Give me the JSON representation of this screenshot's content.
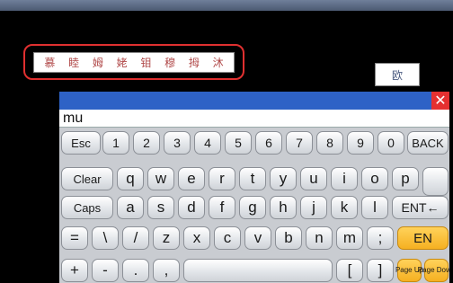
{
  "candidates": [
    "慕",
    "睦",
    "姆",
    "姥",
    "钼",
    "穆",
    "拇",
    "沐"
  ],
  "mode_label": "欧",
  "keyboard": {
    "close_glyph": "✕",
    "input_text": "mu",
    "rows": [
      [
        "Esc",
        "1",
        "2",
        "3",
        "4",
        "5",
        "6",
        "7",
        "8",
        "9",
        "0",
        "BACK"
      ],
      [
        "Clear",
        "q",
        "w",
        "e",
        "r",
        "t",
        "y",
        "u",
        "i",
        "o",
        "p"
      ],
      [
        "Caps",
        "a",
        "s",
        "d",
        "f",
        "g",
        "h",
        "j",
        "k",
        "l",
        "ENT←"
      ],
      [
        "=",
        "\\",
        "/",
        "z",
        "x",
        "c",
        "v",
        "b",
        "n",
        "m",
        ";",
        "EN"
      ],
      [
        "+",
        "-",
        ".",
        ",",
        "",
        "[",
        "]",
        "Page Up",
        "Page Down"
      ]
    ]
  },
  "colors": {
    "candidate_text": "#b04848",
    "frame_red": "#e03030",
    "title_blue": "#2e62c6",
    "close_red": "#e53030",
    "key_orange": "#f5b021"
  }
}
